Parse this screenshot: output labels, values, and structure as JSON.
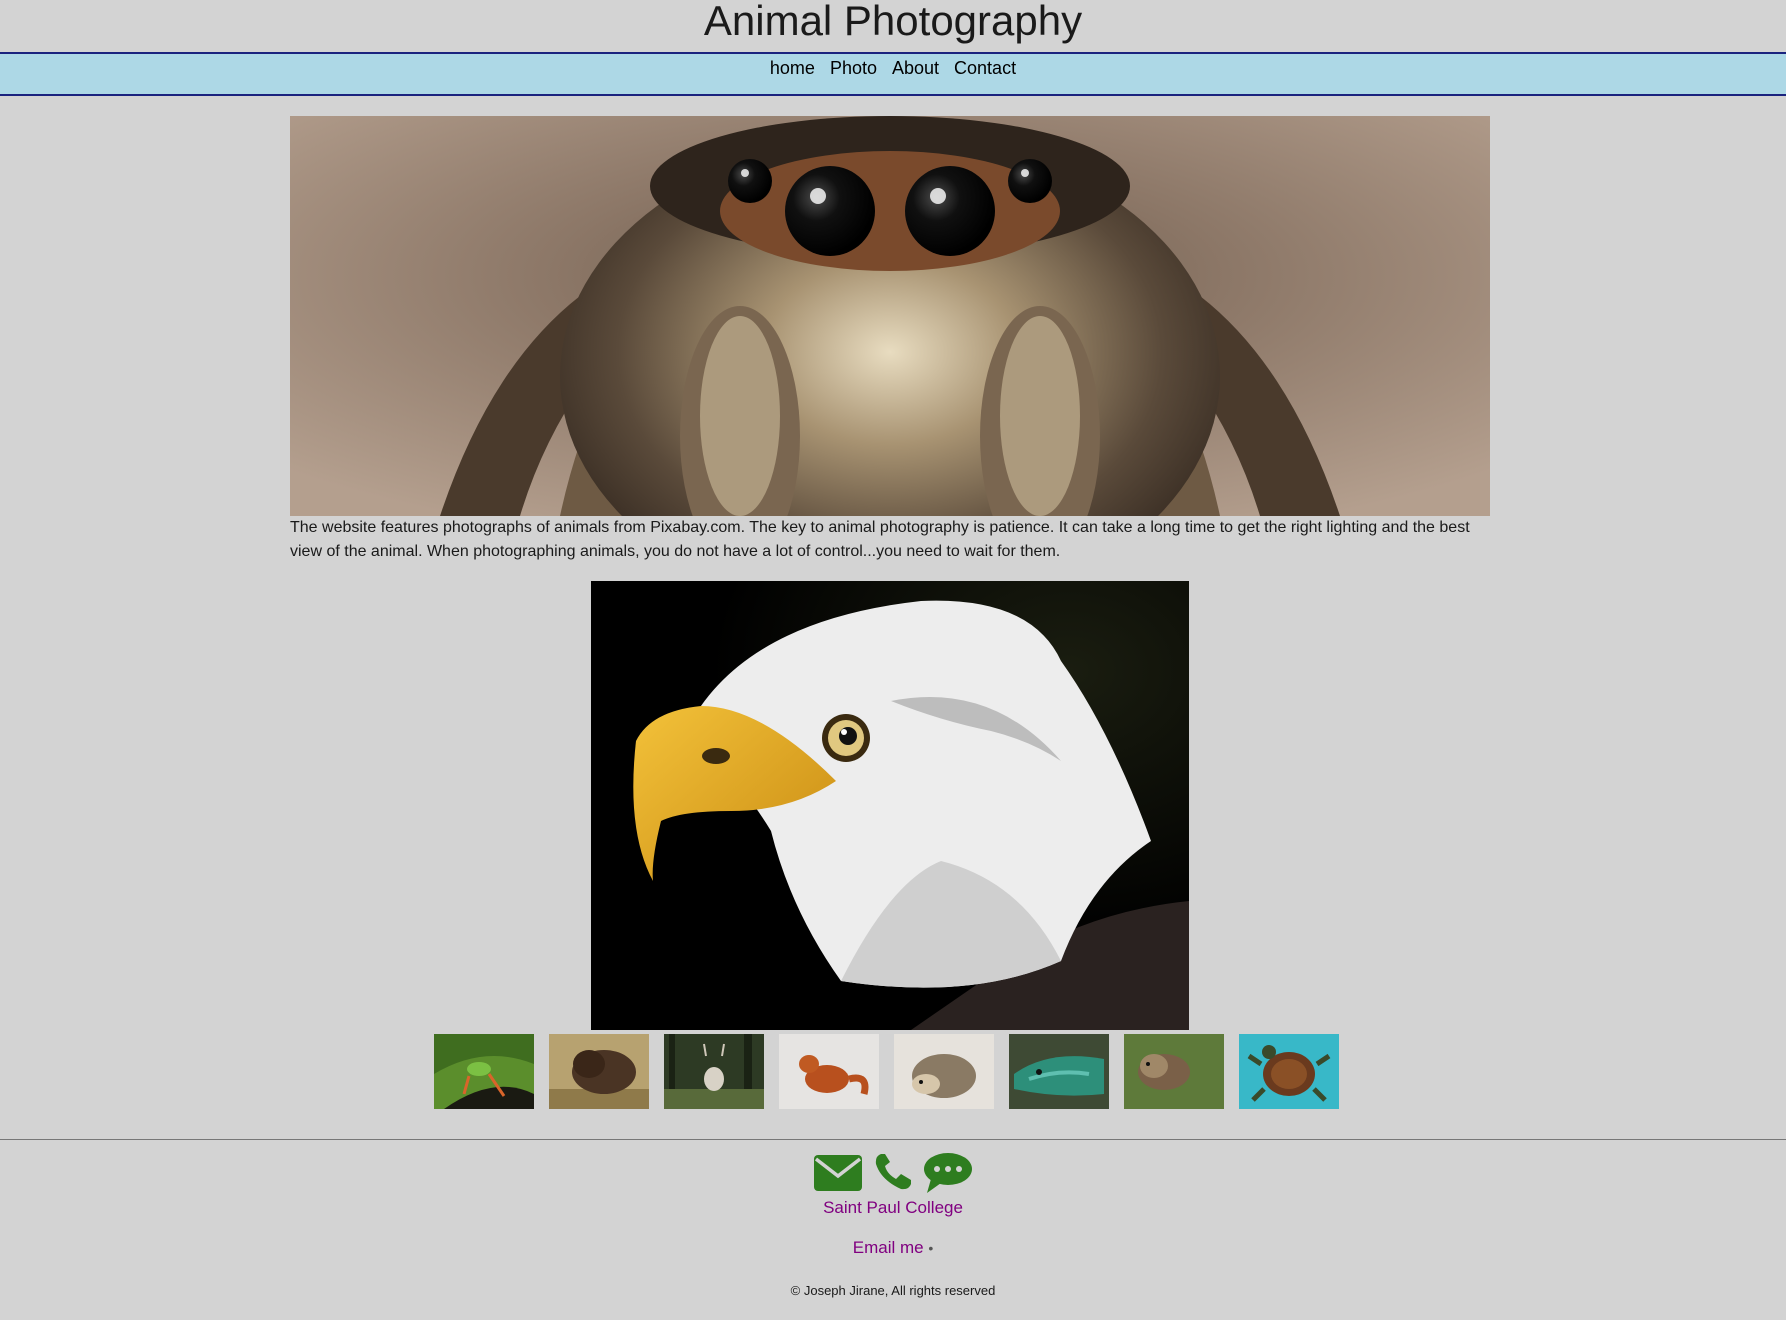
{
  "header": {
    "title": "Animal Photography"
  },
  "nav": {
    "items": [
      {
        "label": "home"
      },
      {
        "label": "Photo"
      },
      {
        "label": "About"
      },
      {
        "label": "Contact"
      }
    ]
  },
  "hero": {
    "subject": "jumping spider close-up"
  },
  "intro": {
    "text": "The website features photographs of animals from Pixabay.com. The key to animal photography is patience. It can take a long time to get the right lighting and the best view of the animal. When photographing animals, you do not have a lot of control...you need to wait for them."
  },
  "featured": {
    "subject": "bald eagle"
  },
  "gallery": {
    "thumbnails": [
      {
        "subject": "frog"
      },
      {
        "subject": "bison"
      },
      {
        "subject": "deer"
      },
      {
        "subject": "fox"
      },
      {
        "subject": "hedgehog"
      },
      {
        "subject": "lizard"
      },
      {
        "subject": "otter"
      },
      {
        "subject": "turtle"
      }
    ]
  },
  "footer": {
    "icons": [
      "envelope-icon",
      "phone-icon",
      "chat-icon"
    ],
    "icon_color": "#2e7d1f",
    "college_link": "Saint Paul College",
    "email_link": "Email me",
    "separator": "•",
    "copyright": "© Joseph Jirane, All rights reserved"
  },
  "colors": {
    "background": "#d3d3d3",
    "nav_background": "#add8e6",
    "nav_border": "#1a237e",
    "link": "#800080"
  }
}
